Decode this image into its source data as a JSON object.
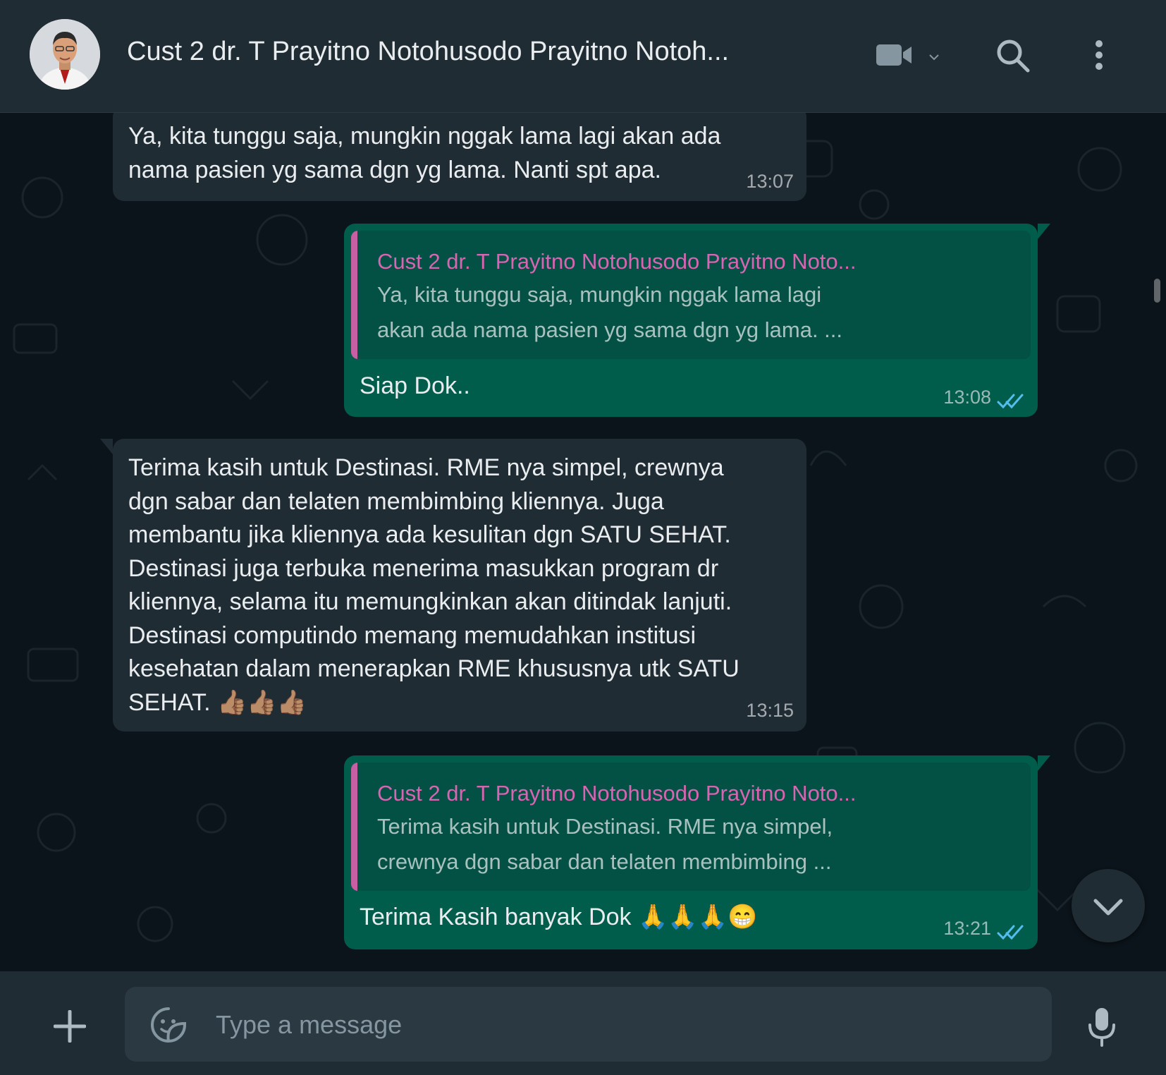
{
  "header": {
    "contact_name": "Cust 2 dr. T Prayitno Notohusodo Prayitno Notoh...",
    "icons": [
      "avatar",
      "video-call-icon",
      "chevron-down-icon",
      "search-icon",
      "menu-icon"
    ]
  },
  "messages": [
    {
      "direction": "incoming",
      "text": "Ya, kita tunggu saja, mungkin nggak lama lagi akan ada\nnama pasien yg sama dgn yg lama. Nanti spt apa.",
      "time": "13:07"
    },
    {
      "direction": "outgoing",
      "quote_author": "Cust 2 dr. T Prayitno Notohusodo Prayitno Noto...",
      "quote_text": "Ya, kita tunggu saja, mungkin nggak lama lagi\nakan ada nama pasien yg sama dgn yg lama. ...",
      "text": "Siap Dok..",
      "time": "13:08",
      "status": "read"
    },
    {
      "direction": "incoming",
      "text": "Terima kasih untuk Destinasi. RME nya simpel, crewnya\ndgn sabar dan telaten membimbing kliennya. Juga\nmembantu jika kliennya ada kesulitan dgn SATU SEHAT.\nDestinasi juga terbuka menerima masukkan program dr\nkliennya, selama itu memungkinkan akan ditindak lanjuti.\nDestinasi computindo memang memudahkan institusi\nkesehatan dalam menerapkan RME khususnya utk SATU\nSEHAT. 👍🏽👍🏽👍🏽",
      "time": "13:15"
    },
    {
      "direction": "outgoing",
      "quote_author": "Cust 2 dr. T Prayitno Notohusodo Prayitno Noto...",
      "quote_text": "Terima kasih untuk Destinasi. RME nya simpel,\ncrewnya dgn sabar dan telaten membimbing ...",
      "text": "Terima Kasih banyak Dok 🙏🙏🙏😁",
      "time": "13:21",
      "status": "read"
    }
  ],
  "composer": {
    "placeholder": "Type a message",
    "icons": [
      "plus-icon",
      "sticker-icon",
      "microphone-icon"
    ]
  },
  "colors": {
    "header_bg": "#202c33",
    "chat_bg": "#0b141a",
    "incoming_bubble": "#202c33",
    "outgoing_bubble": "#005c4b",
    "quote_accent": "#d864b2",
    "read_ticks": "#53bdeb"
  }
}
